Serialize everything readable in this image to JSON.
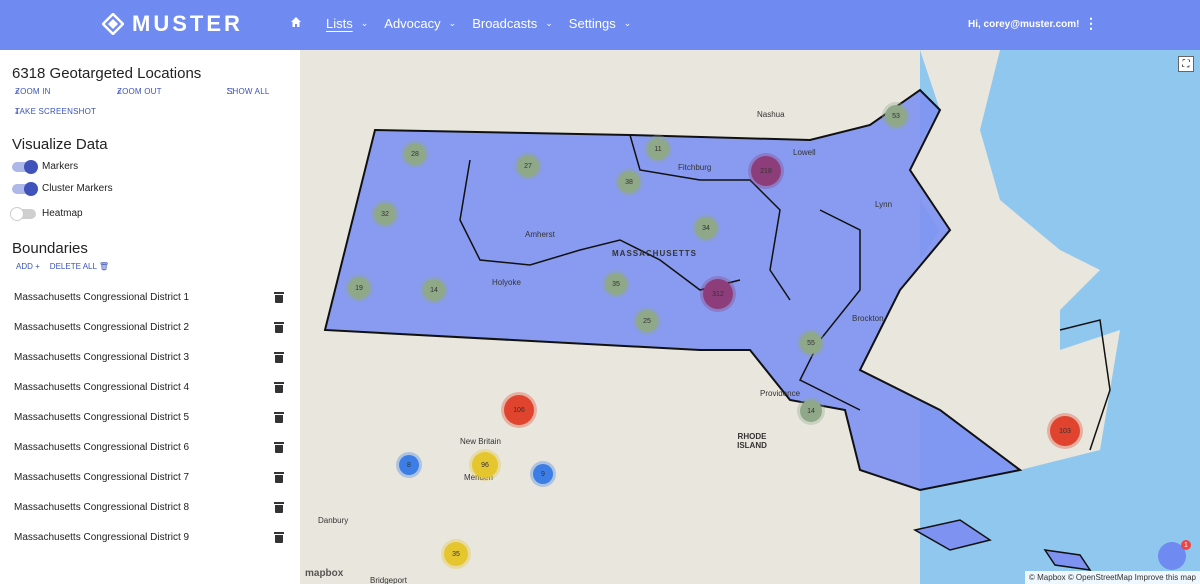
{
  "topbar": {
    "brand": "MUSTER",
    "nav": [
      {
        "label": "Lists",
        "active": true
      },
      {
        "label": "Advocacy",
        "active": false
      },
      {
        "label": "Broadcasts",
        "active": false
      },
      {
        "label": "Settings",
        "active": false
      }
    ],
    "user_greeting": "Hi, corey@muster.com!"
  },
  "sidebar": {
    "title": "6318  Geotargeted Locations",
    "tools": {
      "zoom_in": "ZOOM IN",
      "zoom_out": "ZOOM OUT",
      "show_all": "SHOW ALL",
      "take_screenshot": "TAKE SCREENSHOT"
    },
    "visualize_heading": "Visualize Data",
    "toggles": [
      {
        "label": "Markers",
        "on": true
      },
      {
        "label": "Cluster Markers",
        "on": true
      },
      {
        "label": "Heatmap",
        "on": false
      }
    ],
    "boundaries_heading": "Boundaries",
    "boundary_actions": {
      "add": "ADD",
      "delete_all": "DELETE ALL"
    },
    "districts": [
      "Massachusetts Congressional District 1",
      "Massachusetts Congressional District 2",
      "Massachusetts Congressional District 3",
      "Massachusetts Congressional District 4",
      "Massachusetts Congressional District 5",
      "Massachusetts Congressional District 6",
      "Massachusetts Congressional District 7",
      "Massachusetts Congressional District 8",
      "Massachusetts Congressional District 9"
    ]
  },
  "map": {
    "attribution": "© Mapbox © OpenStreetMap  Improve this map",
    "logo": "mapbox",
    "chat_badge": "1",
    "place_labels": [
      "Nashua",
      "Lowell",
      "Fitchburg",
      "Amherst",
      "MASSACHUSETTS",
      "Holyoke",
      "Lynn",
      "Brockton",
      "Providence",
      "RHODE ISLAND",
      "New Britain",
      "Meriden",
      "Danbury",
      "Bridgeport"
    ],
    "clusters": [
      {
        "count": "28",
        "color": "#8fa888"
      },
      {
        "count": "27",
        "color": "#8fa888"
      },
      {
        "count": "11",
        "color": "#8fa888"
      },
      {
        "count": "53",
        "color": "#8fa888"
      },
      {
        "count": "38",
        "color": "#8fa888"
      },
      {
        "count": "218",
        "color": "#8d3e7a"
      },
      {
        "count": "32",
        "color": "#8fa888"
      },
      {
        "count": "34",
        "color": "#8fa888"
      },
      {
        "count": "19",
        "color": "#8fa888"
      },
      {
        "count": "14",
        "color": "#8fa888"
      },
      {
        "count": "35",
        "color": "#8fa888"
      },
      {
        "count": "312",
        "color": "#8d3e7a"
      },
      {
        "count": "25",
        "color": "#8fa888"
      },
      {
        "count": "55",
        "color": "#8fa888"
      },
      {
        "count": "106",
        "color": "#e0442e"
      },
      {
        "count": "96",
        "color": "#e6c62e"
      },
      {
        "count": "8",
        "color": "#3d7de6"
      },
      {
        "count": "9",
        "color": "#3d7de6"
      },
      {
        "count": "35",
        "color": "#e6c62e"
      },
      {
        "count": "14",
        "color": "#8fa888"
      },
      {
        "count": "103",
        "color": "#e0442e"
      }
    ]
  }
}
